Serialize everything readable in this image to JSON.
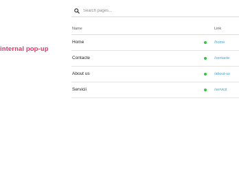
{
  "side_label": "internal pop-up",
  "search": {
    "placeholder": "Search pages..."
  },
  "table": {
    "headers": {
      "name": "Name",
      "link": "Link"
    },
    "rows": [
      {
        "name": "Home",
        "status": "active",
        "link": "/home"
      },
      {
        "name": "Contacte",
        "status": "active",
        "link": "/contacte"
      },
      {
        "name": "About us",
        "status": "active",
        "link": "/about-us"
      },
      {
        "name": "Servicii",
        "status": "active",
        "link": "/servicii"
      }
    ]
  },
  "colors": {
    "label": "#e8336b",
    "status_active": "#33c43f",
    "link": "#3aa3d8"
  }
}
